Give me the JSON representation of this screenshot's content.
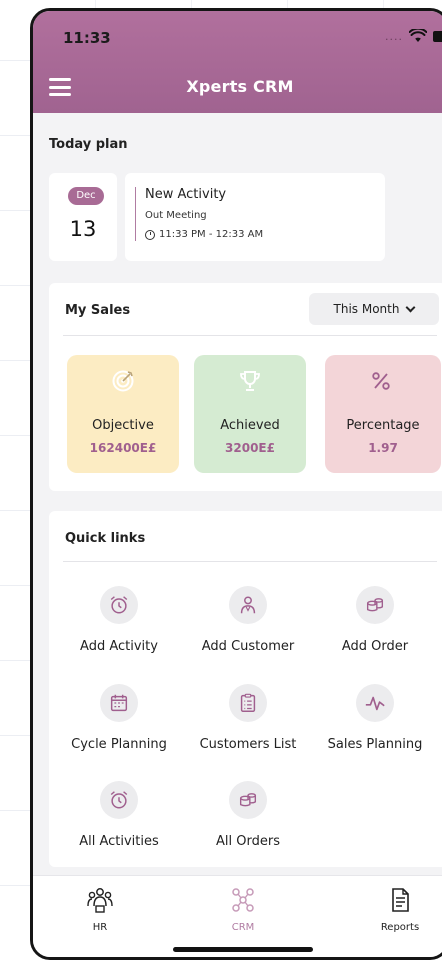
{
  "status_bar": {
    "time": "11:33",
    "signal": "...."
  },
  "header": {
    "title": "Xperts CRM"
  },
  "today_plan": {
    "label": "Today plan",
    "month": "Dec",
    "day": "13",
    "activity": {
      "title": "New Activity",
      "type": "Out Meeting",
      "time": "11:33 PM - 12:33 AM"
    }
  },
  "my_sales": {
    "title": "My Sales",
    "period": "This Month",
    "stats": [
      {
        "label": "Objective",
        "value": "162400E£"
      },
      {
        "label": "Achieved",
        "value": "3200E£"
      },
      {
        "label": "Percentage",
        "value": "1.97"
      }
    ]
  },
  "quick_links": {
    "title": "Quick links",
    "items": [
      {
        "label": "Add Activity",
        "icon": "alarm-clock-icon"
      },
      {
        "label": "Add Customer",
        "icon": "customer-icon"
      },
      {
        "label": "Add Order",
        "icon": "coins-icon"
      },
      {
        "label": "Cycle Planning",
        "icon": "calendar-icon"
      },
      {
        "label": "Customers List",
        "icon": "clipboard-list-icon"
      },
      {
        "label": "Sales Planning",
        "icon": "pulse-chart-icon"
      },
      {
        "label": "All Activities",
        "icon": "alarm-clock-icon"
      },
      {
        "label": "All Orders",
        "icon": "coins-icon"
      }
    ]
  },
  "tab_bar": {
    "active": "CRM",
    "tabs": [
      {
        "label": "HR",
        "icon": "team-icon"
      },
      {
        "label": "CRM",
        "icon": "network-icon"
      },
      {
        "label": "Reports",
        "icon": "report-document-icon"
      }
    ]
  },
  "colors": {
    "header": "#a86b95",
    "accent": "#a05f8e",
    "objective_bg": "#fcecc3",
    "achieved_bg": "#d5ebd2",
    "percentage_bg": "#f3d5d8"
  }
}
